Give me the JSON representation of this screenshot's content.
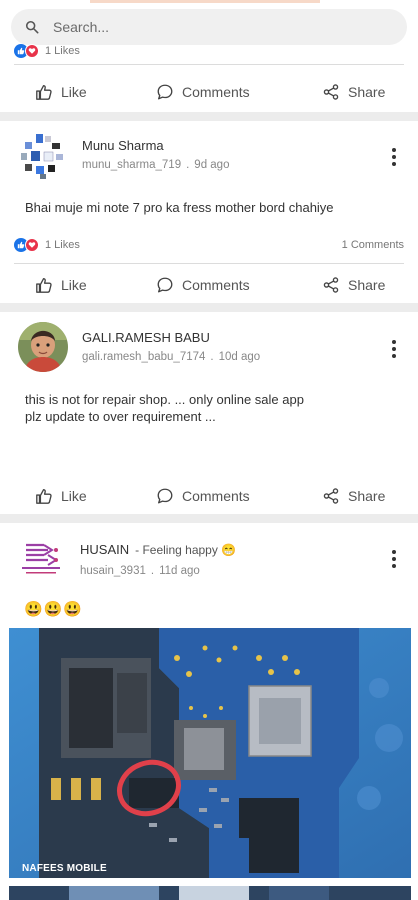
{
  "search": {
    "placeholder": "Search..."
  },
  "actions": {
    "like": "Like",
    "comments": "Comments",
    "share": "Share"
  },
  "posts": [
    {
      "likes": "1 Likes"
    },
    {
      "name": "Munu Sharma",
      "handle": "munu_sharma_719",
      "time": "9d ago",
      "text": "Bhai muje mi note 7 pro ka fress mother bord chahiye",
      "likes": "1 Likes",
      "comments_count": "1 Comments"
    },
    {
      "name": "GALI.RAMESH BABU",
      "handle": "gali.ramesh_babu_7174",
      "time": "10d ago",
      "text_line1": "this is not for repair shop.  ... only online sale app",
      "text_line2": "plz update to over requirement ..."
    },
    {
      "name": "HUSAIN",
      "feeling": "- Feeling happy 😁",
      "handle": "husain_3931",
      "time": "11d ago",
      "emojis": "😃😃😃",
      "image_caption": "NAFEES MOBILE"
    }
  ],
  "separator": "."
}
